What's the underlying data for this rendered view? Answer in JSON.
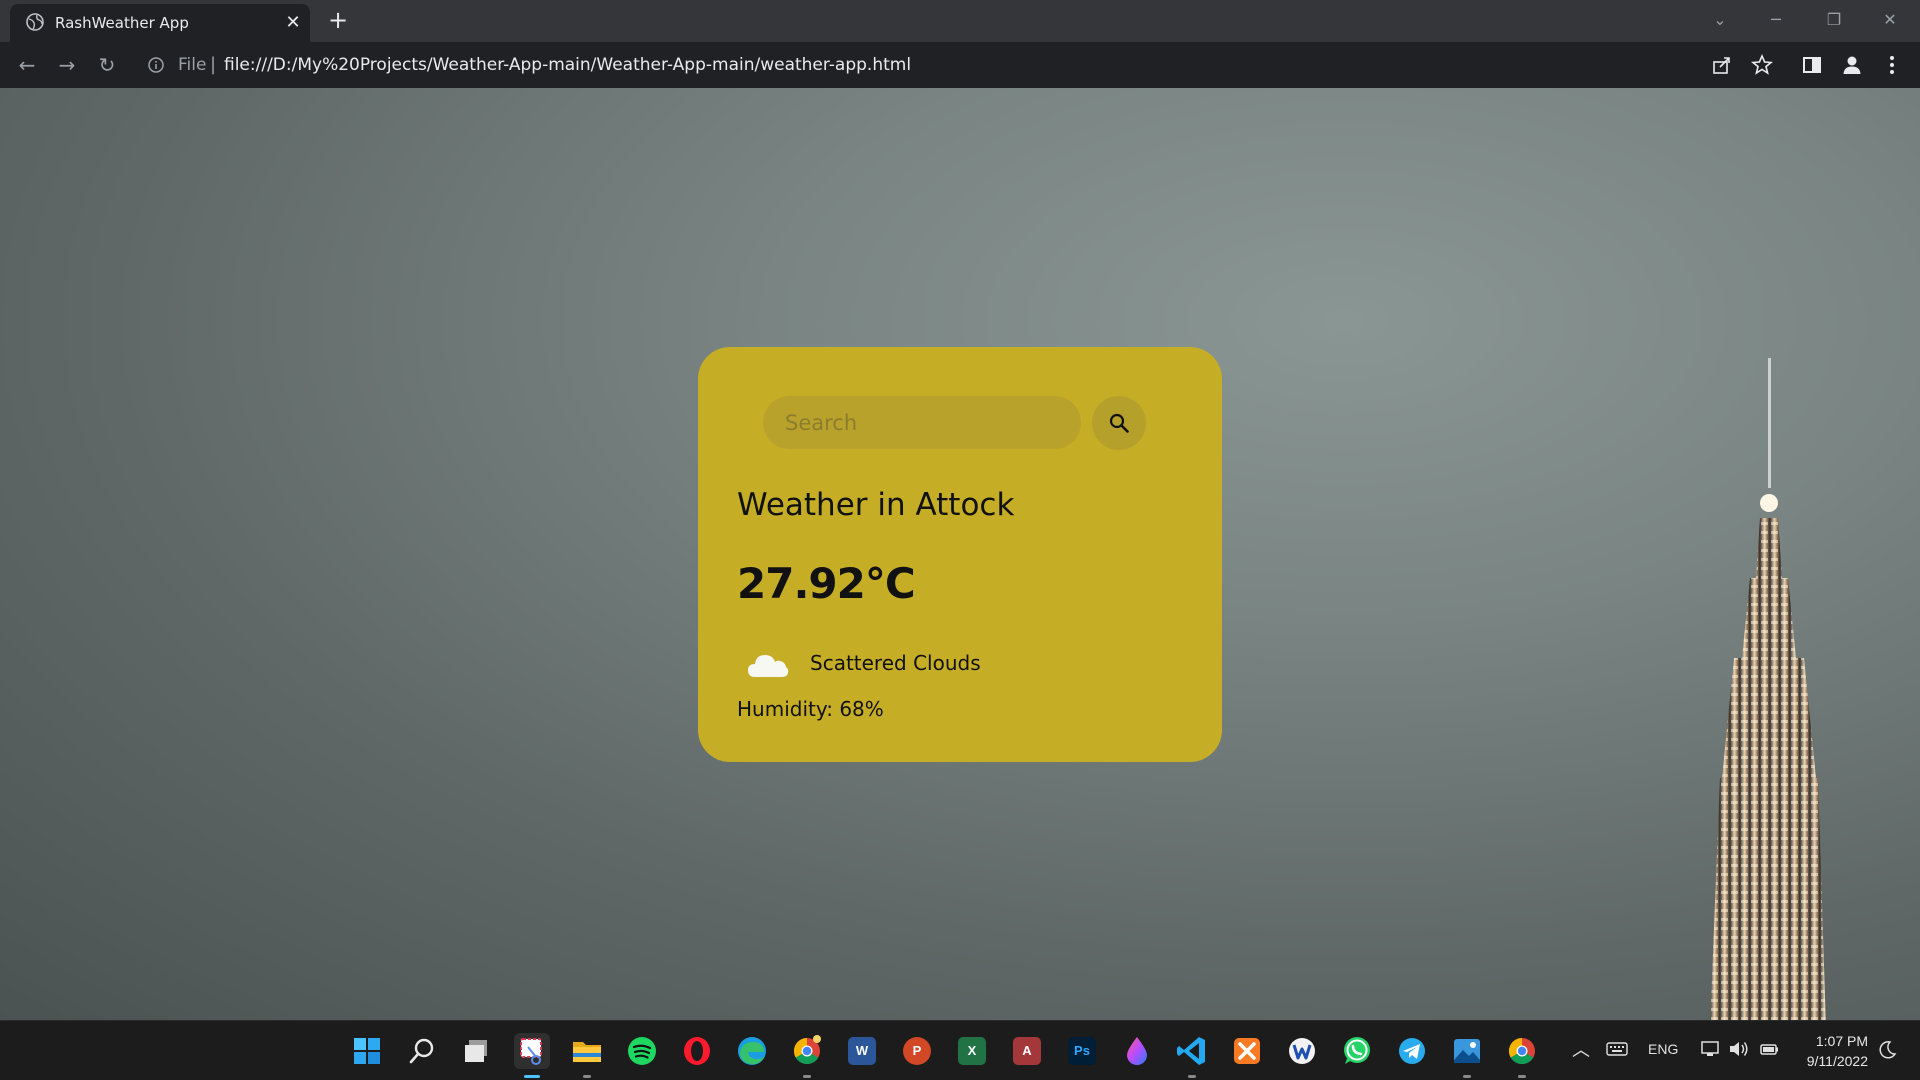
{
  "browser": {
    "tab_title": "RashWeather App",
    "omnibox": {
      "scheme_label": "File",
      "url": "file:///D:/My%20Projects/Weather-App-main/Weather-App-main/weather-app.html"
    }
  },
  "weather_card": {
    "search_placeholder": "Search",
    "search_value": "",
    "city_heading": "Weather in Attock",
    "temperature": "27.92°C",
    "icon": "cloud-icon",
    "description": "Scattered Clouds",
    "humidity": "Humidity: 68%",
    "card_color": "#c5ad26"
  },
  "taskbar": {
    "apps": [
      {
        "name": "start",
        "icon": "windows-icon"
      },
      {
        "name": "search",
        "icon": "search-icon"
      },
      {
        "name": "task-view",
        "icon": "task-view-icon"
      },
      {
        "name": "snipping-tool",
        "icon": "snipping-tool-icon"
      },
      {
        "name": "file-explorer",
        "icon": "folder-icon"
      },
      {
        "name": "spotify",
        "icon": "spotify-icon"
      },
      {
        "name": "opera",
        "icon": "opera-icon"
      },
      {
        "name": "edge",
        "icon": "edge-icon"
      },
      {
        "name": "chrome-canary",
        "icon": "chrome-canary-icon"
      },
      {
        "name": "word",
        "icon": "word-icon",
        "glyph": "W"
      },
      {
        "name": "powerpoint",
        "icon": "powerpoint-icon",
        "glyph": "P"
      },
      {
        "name": "excel",
        "icon": "excel-icon",
        "glyph": "X"
      },
      {
        "name": "access",
        "icon": "access-icon",
        "glyph": "A"
      },
      {
        "name": "photoshop",
        "icon": "photoshop-icon",
        "glyph": "Ps"
      },
      {
        "name": "droplet-app",
        "icon": "droplet-icon"
      },
      {
        "name": "vscode",
        "icon": "vscode-icon"
      },
      {
        "name": "xampp",
        "icon": "xampp-icon"
      },
      {
        "name": "app-w",
        "icon": "w-circle-icon"
      },
      {
        "name": "whatsapp",
        "icon": "whatsapp-icon"
      },
      {
        "name": "telegram",
        "icon": "telegram-icon"
      },
      {
        "name": "photos",
        "icon": "photos-icon"
      },
      {
        "name": "chrome",
        "icon": "chrome-icon"
      }
    ],
    "tray": {
      "language": "ENG",
      "time": "1:07 PM",
      "date": "9/11/2022"
    }
  }
}
